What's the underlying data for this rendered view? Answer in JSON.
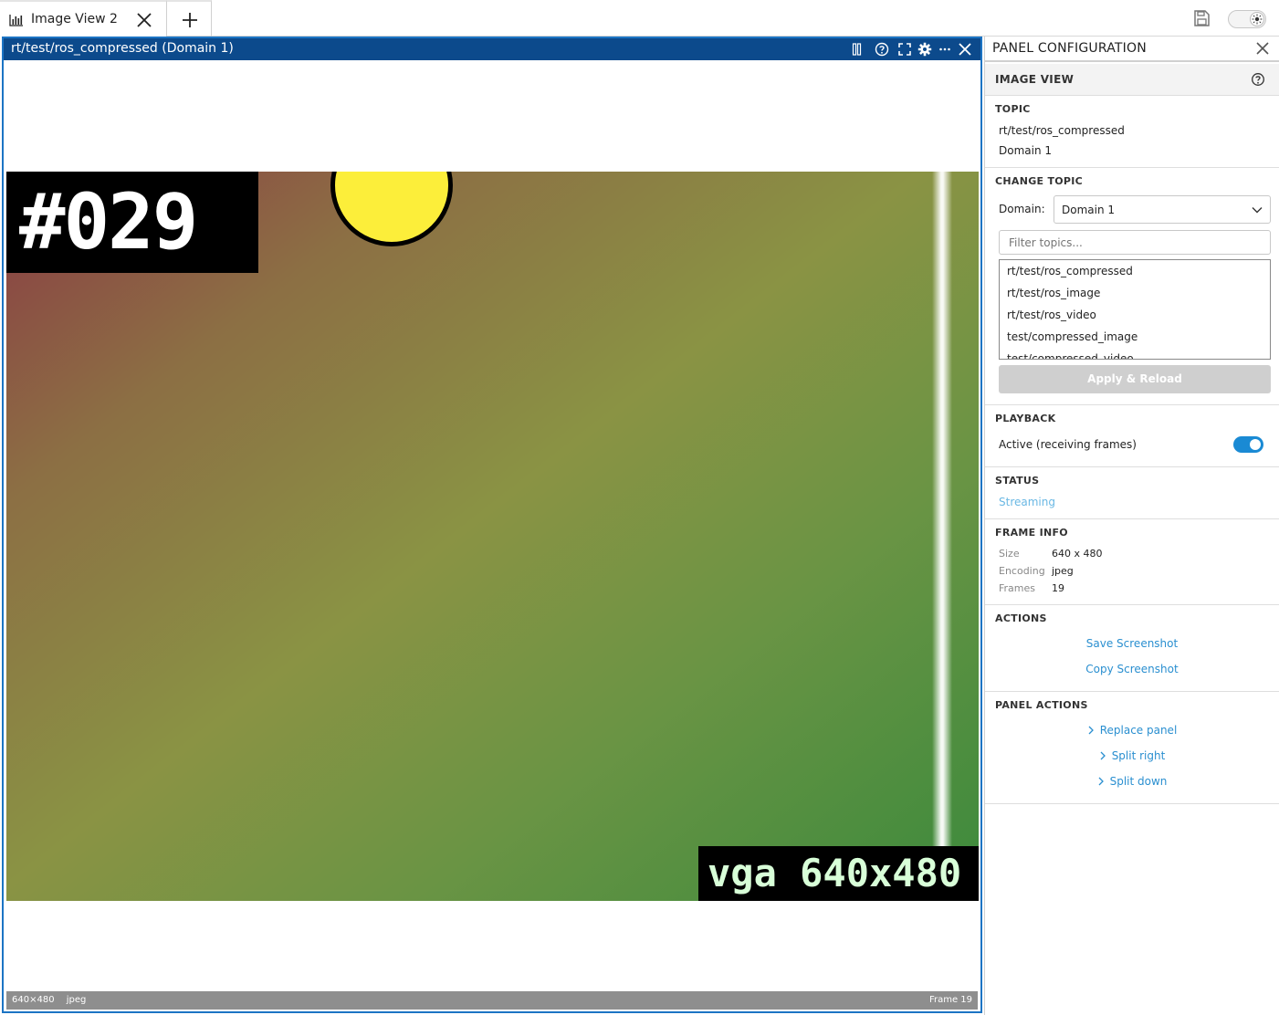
{
  "tabs": [
    {
      "label": "Image View 2",
      "icon": "chart-bars-icon"
    }
  ],
  "panel": {
    "title": "rt/test/ros_compressed (Domain 1)",
    "header_icons": [
      "columns-icon",
      "help-icon",
      "fullscreen-icon",
      "gear-icon",
      "more-icon",
      "close-icon"
    ]
  },
  "image": {
    "frame_label": "#029",
    "resolution_label": "vga 640x480"
  },
  "status_strip": {
    "size": "640×480",
    "encoding": "jpeg",
    "frame": "Frame 19"
  },
  "config": {
    "title": "PANEL CONFIGURATION",
    "section_title": "IMAGE VIEW",
    "topic": {
      "header": "TOPIC",
      "name": "rt/test/ros_compressed",
      "domain": "Domain 1"
    },
    "change_topic": {
      "header": "CHANGE TOPIC",
      "domain_label": "Domain:",
      "domain_value": "Domain 1",
      "filter_placeholder": "Filter topics...",
      "topics": [
        "rt/test/ros_compressed",
        "rt/test/ros_image",
        "rt/test/ros_video",
        "test/compressed_image",
        "test/compressed_video"
      ],
      "apply_label": "Apply & Reload"
    },
    "playback": {
      "header": "PLAYBACK",
      "label": "Active (receiving frames)",
      "active": true
    },
    "status": {
      "header": "STATUS",
      "value": "Streaming"
    },
    "frame_info": {
      "header": "FRAME INFO",
      "size_label": "Size",
      "size": "640 x 480",
      "encoding_label": "Encoding",
      "encoding": "jpeg",
      "frames_label": "Frames",
      "frames": "19"
    },
    "actions": {
      "header": "ACTIONS",
      "save": "Save Screenshot",
      "copy": "Copy Screenshot"
    },
    "panel_actions": {
      "header": "PANEL ACTIONS",
      "replace": "Replace panel",
      "split_right": "Split right",
      "split_down": "Split down"
    }
  },
  "colors": {
    "panel_header": "#0c4a8c",
    "panel_border": "#1c74c4",
    "accent": "#1a8ad4",
    "link": "#2a8fd0"
  }
}
